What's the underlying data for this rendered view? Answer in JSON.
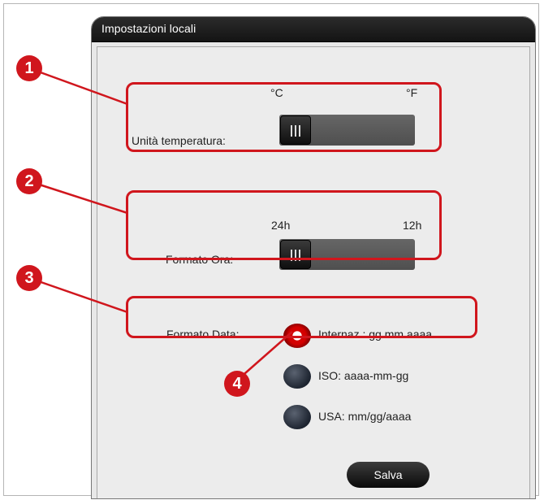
{
  "window": {
    "title": "Impostazioni locali"
  },
  "temperature": {
    "label": "Unità temperatura:",
    "left_option": "°C",
    "right_option": "°F",
    "selected": "°C"
  },
  "time_format": {
    "label": "Formato Ora:",
    "left_option": "24h",
    "right_option": "12h",
    "selected": "24h"
  },
  "date_format": {
    "label": "Formato Data:",
    "options": [
      {
        "label": "Internaz.: gg.mm.aaaa",
        "selected": true
      },
      {
        "label": "ISO: aaaa-mm-gg",
        "selected": false
      },
      {
        "label": "USA: mm/gg/aaaa",
        "selected": false
      }
    ]
  },
  "buttons": {
    "save": "Salva"
  },
  "callouts": [
    "1",
    "2",
    "3",
    "4"
  ],
  "colors": {
    "callout_red": "#d0161d",
    "titlebar": "#1a1a1a",
    "switch": "#5a5a5a"
  }
}
